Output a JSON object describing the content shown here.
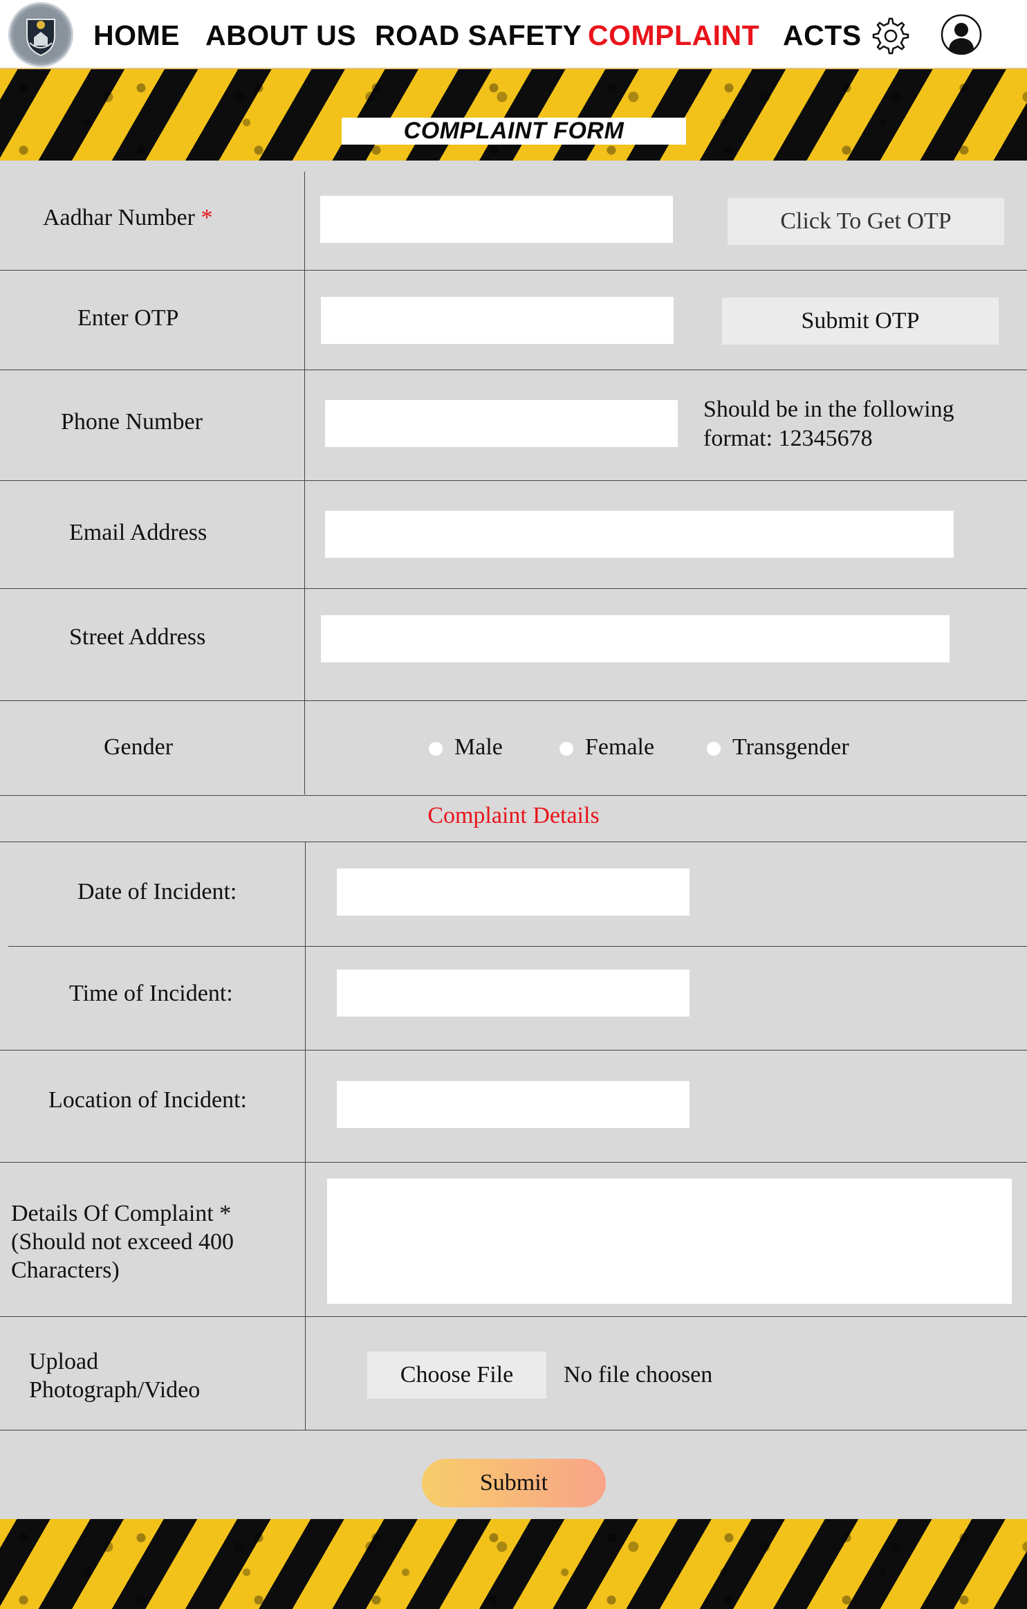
{
  "nav": {
    "items": [
      {
        "label": "HOME",
        "active": false
      },
      {
        "label": "ABOUT US",
        "active": false
      },
      {
        "label": "ROAD SAFETY",
        "active": false
      },
      {
        "label": "COMPLAINT",
        "active": true
      },
      {
        "label": "ACTS",
        "active": false
      }
    ],
    "settings_icon": "gear-icon",
    "profile_icon": "user-icon"
  },
  "banner": {
    "title": "COMPLAINT FORM"
  },
  "form": {
    "aadhar": {
      "label": "Aadhar Number",
      "required_mark": "*",
      "value": "",
      "otp_button": "Click To Get OTP"
    },
    "otp": {
      "label": "Enter  OTP",
      "value": "",
      "submit_button": "Submit OTP"
    },
    "phone": {
      "label": "Phone Number",
      "value": "",
      "hint_line1": "Should be in the following",
      "hint_line2": "format: 12345678"
    },
    "email": {
      "label": "Email Address",
      "value": ""
    },
    "street": {
      "label": "Street Address",
      "value": ""
    },
    "gender": {
      "label": "Gender",
      "options": [
        "Male",
        "Female",
        "Transgender"
      ],
      "selected": null
    }
  },
  "complaint": {
    "section_title": "Complaint Details",
    "date": {
      "label": "Date of Incident:",
      "value": ""
    },
    "time": {
      "label": "Time of Incident:",
      "value": ""
    },
    "location": {
      "label": "Location of Incident:",
      "value": ""
    },
    "details": {
      "label_line1": "Details Of Complaint *",
      "label_line2": "(Should not exceed 400",
      "label_line3": "Characters)",
      "value": ""
    },
    "upload": {
      "label_line1": "Upload",
      "label_line2": "Photograph/Video",
      "button": "Choose File",
      "status": "No file choosen"
    }
  },
  "submit_label": "Submit",
  "colors": {
    "accent_red": "#e8141b",
    "stripe_yellow": "#f2c21a",
    "stripe_black": "#0d0d0d",
    "form_bg": "#d9d9d9"
  }
}
